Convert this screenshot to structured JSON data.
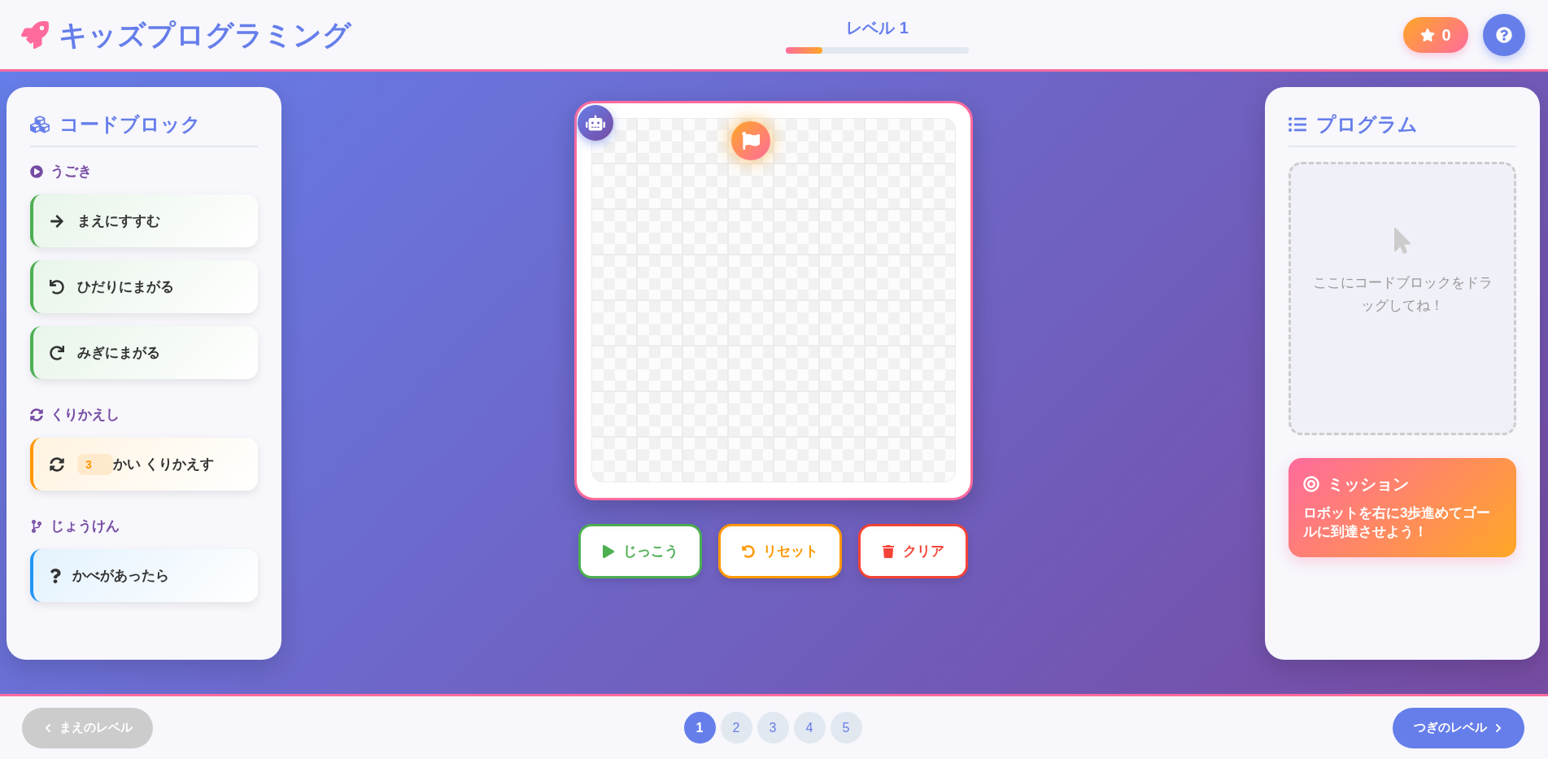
{
  "header": {
    "title": "キッズプログラミング",
    "level_label": "レベル 1",
    "progress": {
      "level": 0.2
    },
    "stars": "0"
  },
  "palette": {
    "title": "コードブロック",
    "categories": [
      {
        "kind": "motion",
        "label": "うごき",
        "blocks": [
          {
            "kind": "forward",
            "label": "まえにすすむ"
          },
          {
            "kind": "turn_left",
            "label": "ひだりにまがる"
          },
          {
            "kind": "turn_right",
            "label": "みぎにまがる"
          }
        ]
      },
      {
        "kind": "loop",
        "label": "くりかえし",
        "blocks": [
          {
            "kind": "repeat",
            "count": "3",
            "label": "かい くりかえす"
          }
        ]
      },
      {
        "kind": "condition",
        "label": "じょうけん",
        "blocks": [
          {
            "kind": "if_wall",
            "label": "かべがあったら"
          }
        ]
      }
    ]
  },
  "board": {
    "rows": [
      [
        {
          "kind": "start"
        },
        {
          "kind": "empty"
        },
        {
          "kind": "empty"
        },
        {
          "kind": "goal"
        },
        {
          "kind": "empty"
        },
        {
          "kind": "empty"
        },
        {
          "kind": "empty"
        },
        {
          "kind": "empty"
        }
      ],
      [
        {
          "kind": "empty"
        },
        {
          "kind": "empty"
        },
        {
          "kind": "empty"
        },
        {
          "kind": "empty"
        },
        {
          "kind": "empty"
        },
        {
          "kind": "empty"
        },
        {
          "kind": "empty"
        },
        {
          "kind": "empty"
        }
      ],
      [
        {
          "kind": "empty"
        },
        {
          "kind": "empty"
        },
        {
          "kind": "empty"
        },
        {
          "kind": "empty"
        },
        {
          "kind": "empty"
        },
        {
          "kind": "empty"
        },
        {
          "kind": "empty"
        },
        {
          "kind": "empty"
        }
      ],
      [
        {
          "kind": "empty"
        },
        {
          "kind": "empty"
        },
        {
          "kind": "empty"
        },
        {
          "kind": "empty"
        },
        {
          "kind": "empty"
        },
        {
          "kind": "empty"
        },
        {
          "kind": "empty"
        },
        {
          "kind": "empty"
        }
      ],
      [
        {
          "kind": "empty"
        },
        {
          "kind": "empty"
        },
        {
          "kind": "empty"
        },
        {
          "kind": "empty"
        },
        {
          "kind": "empty"
        },
        {
          "kind": "empty"
        },
        {
          "kind": "empty"
        },
        {
          "kind": "empty"
        }
      ],
      [
        {
          "kind": "empty"
        },
        {
          "kind": "empty"
        },
        {
          "kind": "empty"
        },
        {
          "kind": "empty"
        },
        {
          "kind": "empty"
        },
        {
          "kind": "empty"
        },
        {
          "kind": "empty"
        },
        {
          "kind": "empty"
        }
      ],
      [
        {
          "kind": "empty"
        },
        {
          "kind": "empty"
        },
        {
          "kind": "empty"
        },
        {
          "kind": "empty"
        },
        {
          "kind": "empty"
        },
        {
          "kind": "empty"
        },
        {
          "kind": "empty"
        },
        {
          "kind": "empty"
        }
      ],
      [
        {
          "kind": "empty"
        },
        {
          "kind": "empty"
        },
        {
          "kind": "empty"
        },
        {
          "kind": "empty"
        },
        {
          "kind": "empty"
        },
        {
          "kind": "empty"
        },
        {
          "kind": "empty"
        },
        {
          "kind": "empty"
        }
      ]
    ]
  },
  "actions": [
    {
      "kind": "run",
      "label": "じっこう"
    },
    {
      "kind": "reset",
      "label": "リセット"
    },
    {
      "kind": "clear",
      "label": "クリア"
    }
  ],
  "program": {
    "title": "プログラム",
    "empty_hint": "ここにコードブロックをドラッグしてね！"
  },
  "mission": {
    "title": "ミッション",
    "text": "ロボットを右に3歩進めてゴールに到達させよう！"
  },
  "footer": {
    "prev": {
      "label": "まえのレベル",
      "disabled": true
    },
    "pages": [
      {
        "label": "1",
        "selected": true
      },
      {
        "label": "2",
        "selected": false
      },
      {
        "label": "3",
        "selected": false
      },
      {
        "label": "4",
        "selected": false
      },
      {
        "label": "5",
        "selected": false
      }
    ],
    "next": {
      "label": "つぎのレベル",
      "disabled": false
    }
  }
}
